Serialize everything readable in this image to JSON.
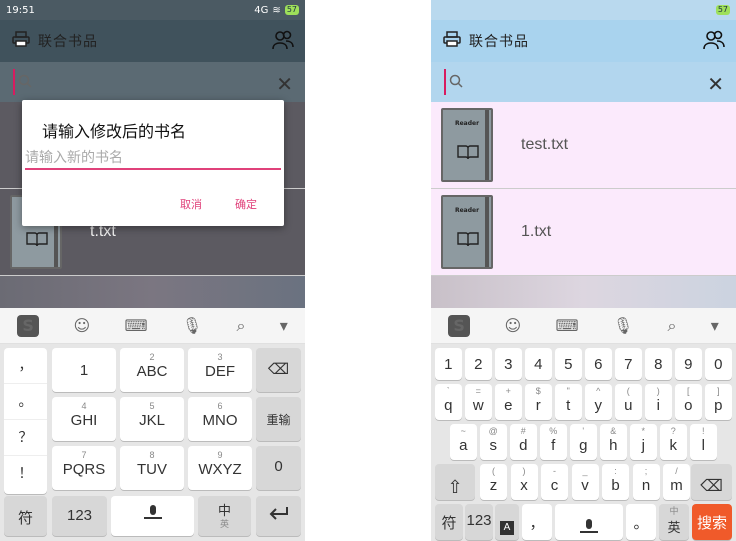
{
  "left": {
    "status": {
      "time": "19:51",
      "network": "4G",
      "battery": "57"
    },
    "app_title": "联合书品",
    "books": [
      {
        "name": "t.txt"
      }
    ],
    "dialog": {
      "title": "请输入修改后的书名",
      "placeholder": "请输入新的书名",
      "cancel": "取消",
      "confirm": "确定"
    },
    "keyboard": {
      "left_column": [
        "，",
        "。",
        "？",
        "！"
      ],
      "rows": [
        [
          {
            "sub": "",
            "main": "1"
          },
          {
            "sub": "2",
            "main": "ABC"
          },
          {
            "sub": "3",
            "main": "DEF"
          }
        ],
        [
          {
            "sub": "4",
            "main": "GHI"
          },
          {
            "sub": "5",
            "main": "JKL"
          },
          {
            "sub": "6",
            "main": "MNO"
          }
        ],
        [
          {
            "sub": "7",
            "main": "PQRS"
          },
          {
            "sub": "8",
            "main": "TUV"
          },
          {
            "sub": "9",
            "main": "WXYZ"
          }
        ]
      ],
      "right_column": [
        "⌫",
        "重输",
        "0"
      ],
      "bottom": {
        "fu": "符",
        "num": "123",
        "zhong": "中",
        "ying": "英"
      }
    }
  },
  "right": {
    "status": {
      "battery": "57"
    },
    "app_title": "联合书品",
    "books": [
      {
        "name": "test.txt",
        "brand": "Reader"
      },
      {
        "name": "1.txt",
        "brand": "Reader"
      }
    ],
    "keyboard": {
      "numbers": [
        "1",
        "2",
        "3",
        "4",
        "5",
        "6",
        "7",
        "8",
        "9",
        "0"
      ],
      "row1": [
        {
          "sub": "`",
          "main": "q"
        },
        {
          "sub": "=",
          "main": "w"
        },
        {
          "sub": "+",
          "main": "e"
        },
        {
          "sub": "$",
          "main": "r"
        },
        {
          "sub": "\"",
          "main": "t"
        },
        {
          "sub": "^",
          "main": "y"
        },
        {
          "sub": "(",
          "main": "u"
        },
        {
          "sub": ")",
          "main": "i"
        },
        {
          "sub": "[",
          "main": "o"
        },
        {
          "sub": "]",
          "main": "p"
        }
      ],
      "row2": [
        {
          "sub": "~",
          "main": "a"
        },
        {
          "sub": "@",
          "main": "s"
        },
        {
          "sub": "#",
          "main": "d"
        },
        {
          "sub": "%",
          "main": "f"
        },
        {
          "sub": "'",
          "main": "g"
        },
        {
          "sub": "&",
          "main": "h"
        },
        {
          "sub": "*",
          "main": "j"
        },
        {
          "sub": "?",
          "main": "k"
        },
        {
          "sub": "!",
          "main": "l"
        }
      ],
      "row3": [
        {
          "sub": "(",
          "main": "z"
        },
        {
          "sub": ")",
          "main": "x"
        },
        {
          "sub": "-",
          "main": "c"
        },
        {
          "sub": "_",
          "main": "v"
        },
        {
          "sub": ":",
          "main": "b"
        },
        {
          "sub": ";",
          "main": "n"
        },
        {
          "sub": "/",
          "main": "m"
        }
      ],
      "bottom": {
        "fu": "符",
        "num": "123",
        "a": "A",
        "comma": "，",
        "dot": "。",
        "zhong": "中",
        "ying": "英",
        "search": "搜索"
      }
    }
  },
  "colors": {
    "accent": "#e0417a",
    "enter": "#f05a2a"
  }
}
